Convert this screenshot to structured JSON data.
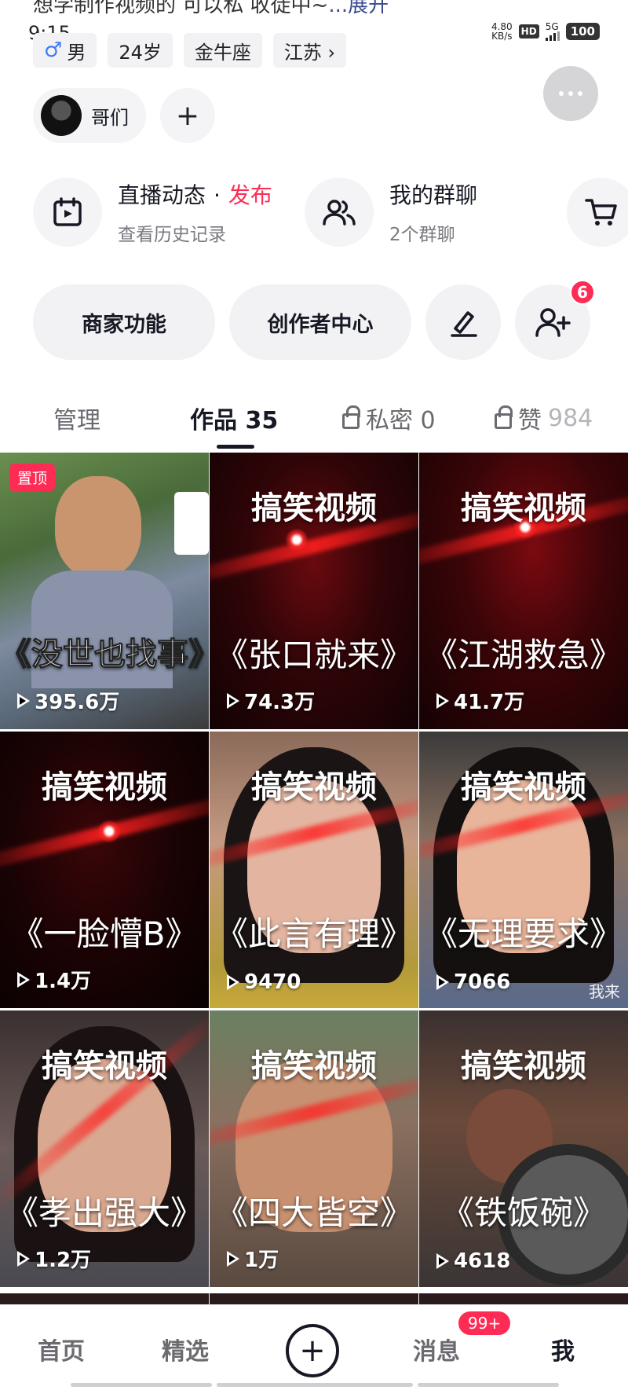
{
  "bio": {
    "text": "想学制作视频的 可以私 收徒中~",
    "more": "...展开"
  },
  "status_bar": {
    "time": "9:15",
    "speed_value": "4.80",
    "speed_unit": "KB/s",
    "hd": "HD",
    "network": "5G",
    "battery": "100"
  },
  "profile_tags": {
    "gender": "男",
    "gender_icon": "♂",
    "age": "24岁",
    "zodiac": "金牛座",
    "location": "江苏 ›"
  },
  "friend": {
    "name": "哥们",
    "add_icon": "+"
  },
  "features": {
    "live": {
      "title": "直播动态",
      "dot": "·",
      "publish": "发布",
      "subtitle": "查看历史记录"
    },
    "groups": {
      "title": "我的群聊",
      "subtitle": "2个群聊"
    }
  },
  "actions": {
    "merchant": "商家功能",
    "creator": "创作者中心",
    "follow_badge": "6"
  },
  "tabs": {
    "manage": "管理",
    "works": "作品 35",
    "private": "私密 0",
    "likes_label": "赞",
    "likes_count": "984"
  },
  "videos": [
    {
      "category": "",
      "title": "《没世也找事》",
      "views": "395.6万",
      "pinned": "置顶"
    },
    {
      "category": "搞笑视频",
      "title": "《张口就来》",
      "views": "74.3万"
    },
    {
      "category": "搞笑视频",
      "title": "《江湖救急》",
      "views": "41.7万"
    },
    {
      "category": "搞笑视频",
      "title": "《一脸懵B》",
      "views": "1.4万"
    },
    {
      "category": "搞笑视频",
      "title": "《此言有理》",
      "views": "9470"
    },
    {
      "category": "搞笑视频",
      "title": "《无理要求》",
      "views": "7066",
      "caption": "我来"
    },
    {
      "category": "搞笑视频",
      "title": "《孝出强大》",
      "views": "1.2万"
    },
    {
      "category": "搞笑视频",
      "title": "《四大皆空》",
      "views": "1万"
    },
    {
      "category": "搞笑视频",
      "title": "《铁饭碗》",
      "views": "4618"
    }
  ],
  "nav": {
    "home": "首页",
    "featured": "精选",
    "plus": "+",
    "messages": "消息",
    "messages_badge": "99+",
    "me": "我"
  },
  "colors": {
    "accent": "#fe2c55",
    "text": "#161823",
    "muted": "#6a6a70"
  }
}
